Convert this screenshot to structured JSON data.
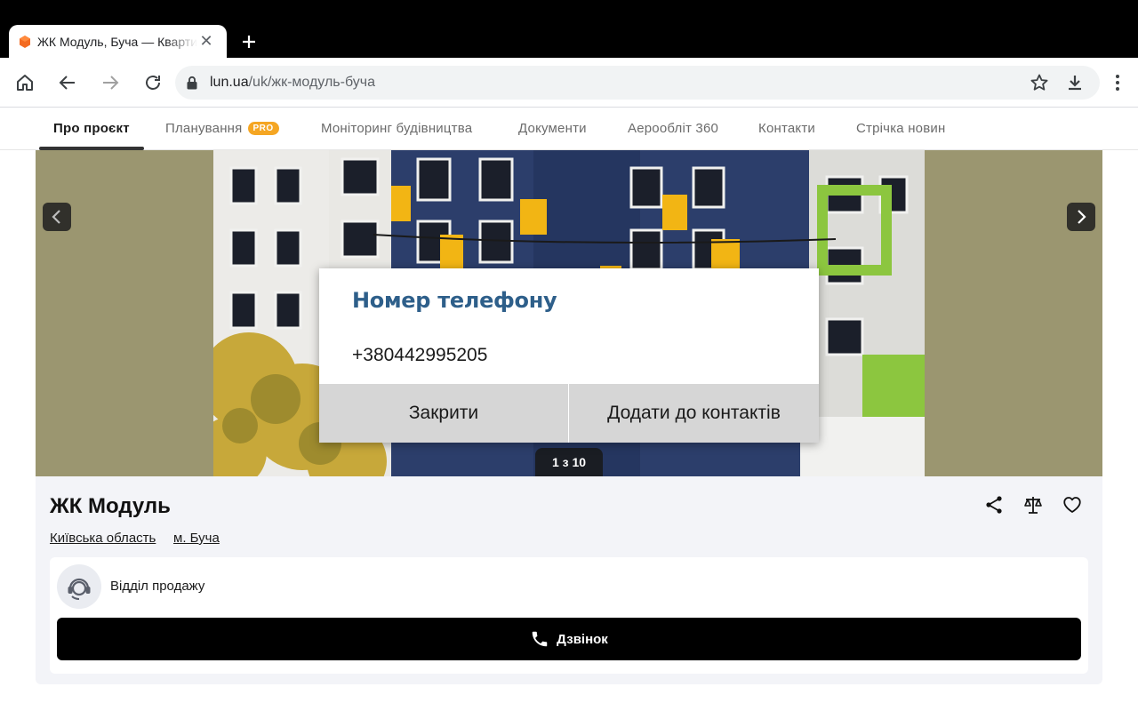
{
  "browser": {
    "tab_title": "ЖК Модуль, Буча — Квартири",
    "url_host": "lun.ua",
    "url_path": "/uk/жк-модуль-буча"
  },
  "page_nav": {
    "items": [
      {
        "label": "Про проєкт",
        "active": true
      },
      {
        "label": "Планування",
        "badge": "PRO"
      },
      {
        "label": "Моніторинг будівництва"
      },
      {
        "label": "Документи"
      },
      {
        "label": "Аерообліт 360"
      },
      {
        "label": "Контакти"
      },
      {
        "label": "Стрічка новин"
      }
    ]
  },
  "gallery": {
    "counter": "1 з 10"
  },
  "dialog": {
    "title": "Номер телефону",
    "phone": "+380442995205",
    "close_label": "Закрити",
    "add_label": "Додати до контактів"
  },
  "project": {
    "title": "ЖК Модуль",
    "region": "Київська область",
    "city": "м. Буча",
    "sales_label": "Відділ продажу",
    "call_label": "Дзвінок"
  },
  "colors": {
    "accent_badge": "#f5a623",
    "dialog_title": "#2e5f8a",
    "gallery_bg": "#9b9670"
  }
}
